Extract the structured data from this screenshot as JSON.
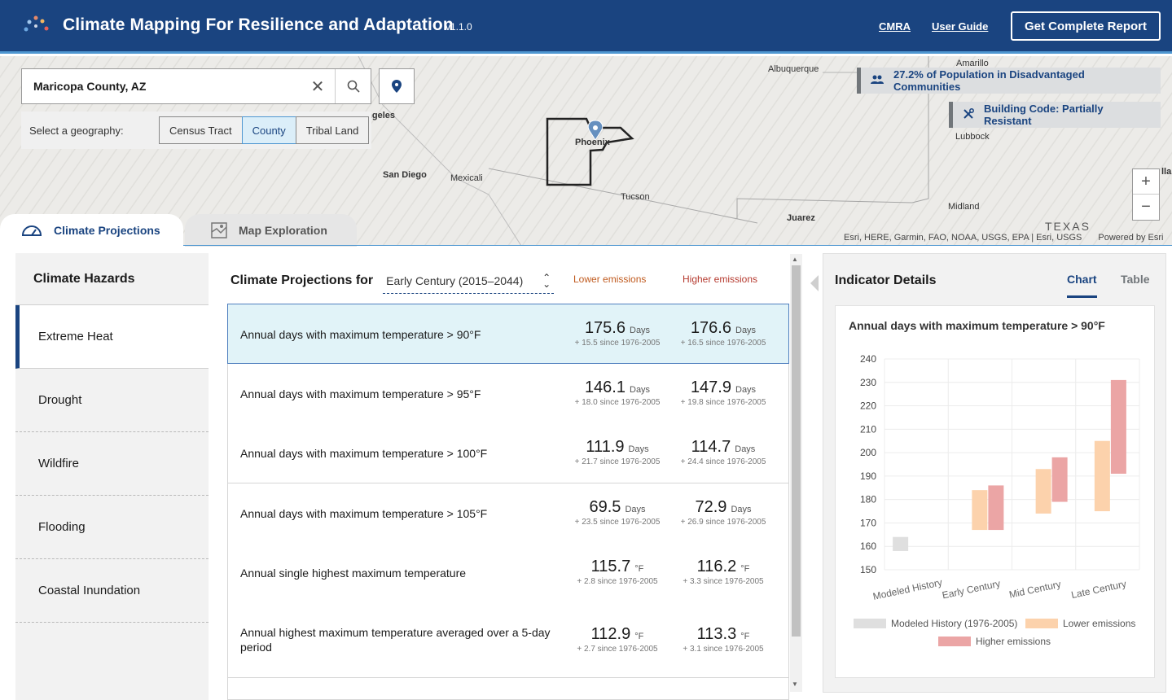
{
  "header": {
    "title": "Climate Mapping For Resilience and Adaptation",
    "version": "v1.1.0",
    "links": {
      "cmra": "CMRA",
      "guide": "User Guide"
    },
    "report_button": "Get Complete Report"
  },
  "map": {
    "search_value": "Maricopa County, AZ",
    "geo_label": "Select a geography:",
    "geo_options": [
      "Census Tract",
      "County",
      "Tribal Land"
    ],
    "geo_selected": "County",
    "badges": {
      "population": "27.2% of Population in Disadvantaged Communities",
      "building": "Building Code: Partially Resistant"
    },
    "places": {
      "albuquerque": "Albuquerque",
      "amarillo": "Amarillo",
      "lubbock": "Lubbock",
      "phoenix": "Phoenix",
      "tucson": "Tucson",
      "sandiego": "San Diego",
      "mexicali": "Mexicali",
      "losangeles": "Los Angeles",
      "midland": "Midland",
      "juarez": "Juarez",
      "texas": "TEXAS",
      "dallas": "lla"
    },
    "attribution": "Esri, HERE, Garmin, FAO, NOAA, USGS, EPA | Esri, USGS",
    "powered": "Powered by Esri",
    "zoom_in": "+",
    "zoom_out": "−"
  },
  "tabs": {
    "projections": "Climate Projections",
    "exploration": "Map Exploration"
  },
  "sidebar": {
    "title": "Climate Hazards",
    "items": [
      "Extreme Heat",
      "Drought",
      "Wildfire",
      "Flooding",
      "Coastal Inundation"
    ],
    "active": "Extreme Heat"
  },
  "projections": {
    "title": "Climate Projections for",
    "period": "Early Century (2015–2044)",
    "lower_label": "Lower emissions",
    "higher_label": "Higher emissions",
    "rows": [
      {
        "label": "Annual days with maximum temperature > 90°F",
        "lower": "175.6",
        "lower_unit": "Days",
        "lower_delta": "+ 15.5 since 1976-2005",
        "higher": "176.6",
        "higher_unit": "Days",
        "higher_delta": "+ 16.5 since 1976-2005"
      },
      {
        "label": "Annual days with maximum temperature > 95°F",
        "lower": "146.1",
        "lower_unit": "Days",
        "lower_delta": "+ 18.0 since 1976-2005",
        "higher": "147.9",
        "higher_unit": "Days",
        "higher_delta": "+ 19.8 since 1976-2005"
      },
      {
        "label": "Annual days with maximum temperature > 100°F",
        "lower": "111.9",
        "lower_unit": "Days",
        "lower_delta": "+ 21.7 since 1976-2005",
        "higher": "114.7",
        "higher_unit": "Days",
        "higher_delta": "+ 24.4 since 1976-2005"
      },
      {
        "label": "Annual days with maximum temperature > 105°F",
        "lower": "69.5",
        "lower_unit": "Days",
        "lower_delta": "+ 23.5 since 1976-2005",
        "higher": "72.9",
        "higher_unit": "Days",
        "higher_delta": "+ 26.9 since 1976-2005"
      },
      {
        "label": "Annual single highest maximum temperature",
        "lower": "115.7",
        "lower_unit": "°F",
        "lower_delta": "+ 2.8 since 1976-2005",
        "higher": "116.2",
        "higher_unit": "°F",
        "higher_delta": "+ 3.3 since 1976-2005"
      },
      {
        "label": "Annual highest maximum temperature averaged over a 5-day period",
        "lower": "112.9",
        "lower_unit": "°F",
        "lower_delta": "+ 2.7 since 1976-2005",
        "higher": "113.3",
        "higher_unit": "°F",
        "higher_delta": "+ 3.1 since 1976-2005"
      }
    ]
  },
  "indicator": {
    "title": "Indicator Details",
    "tab_chart": "Chart",
    "tab_table": "Table",
    "chart_title": "Annual days with maximum temperature > 90°F",
    "legend": [
      "Modeled History (1976-2005)",
      "Lower emissions",
      "Higher emissions"
    ]
  },
  "colors": {
    "header": "#1a4480",
    "history": "#dfdfdf",
    "lower": "#fcd2ac",
    "higher": "#eba5a5"
  },
  "chart_data": {
    "type": "bar",
    "title": "Annual days with maximum temperature > 90°F",
    "categories": [
      "Modeled History",
      "Early Century",
      "Mid Century",
      "Late Century"
    ],
    "ylim": [
      150,
      240
    ],
    "yticks": [
      150,
      160,
      170,
      180,
      190,
      200,
      210,
      220,
      230,
      240
    ],
    "grid": true,
    "legend": "bottom",
    "series": [
      {
        "name": "Modeled History (1976-2005)",
        "ranges": [
          [
            158,
            164
          ],
          null,
          null,
          null
        ]
      },
      {
        "name": "Lower emissions",
        "ranges": [
          null,
          [
            167,
            184
          ],
          [
            174,
            193
          ],
          [
            175,
            205
          ]
        ]
      },
      {
        "name": "Higher emissions",
        "ranges": [
          null,
          [
            167,
            186
          ],
          [
            179,
            198
          ],
          [
            191,
            231
          ]
        ]
      }
    ]
  }
}
